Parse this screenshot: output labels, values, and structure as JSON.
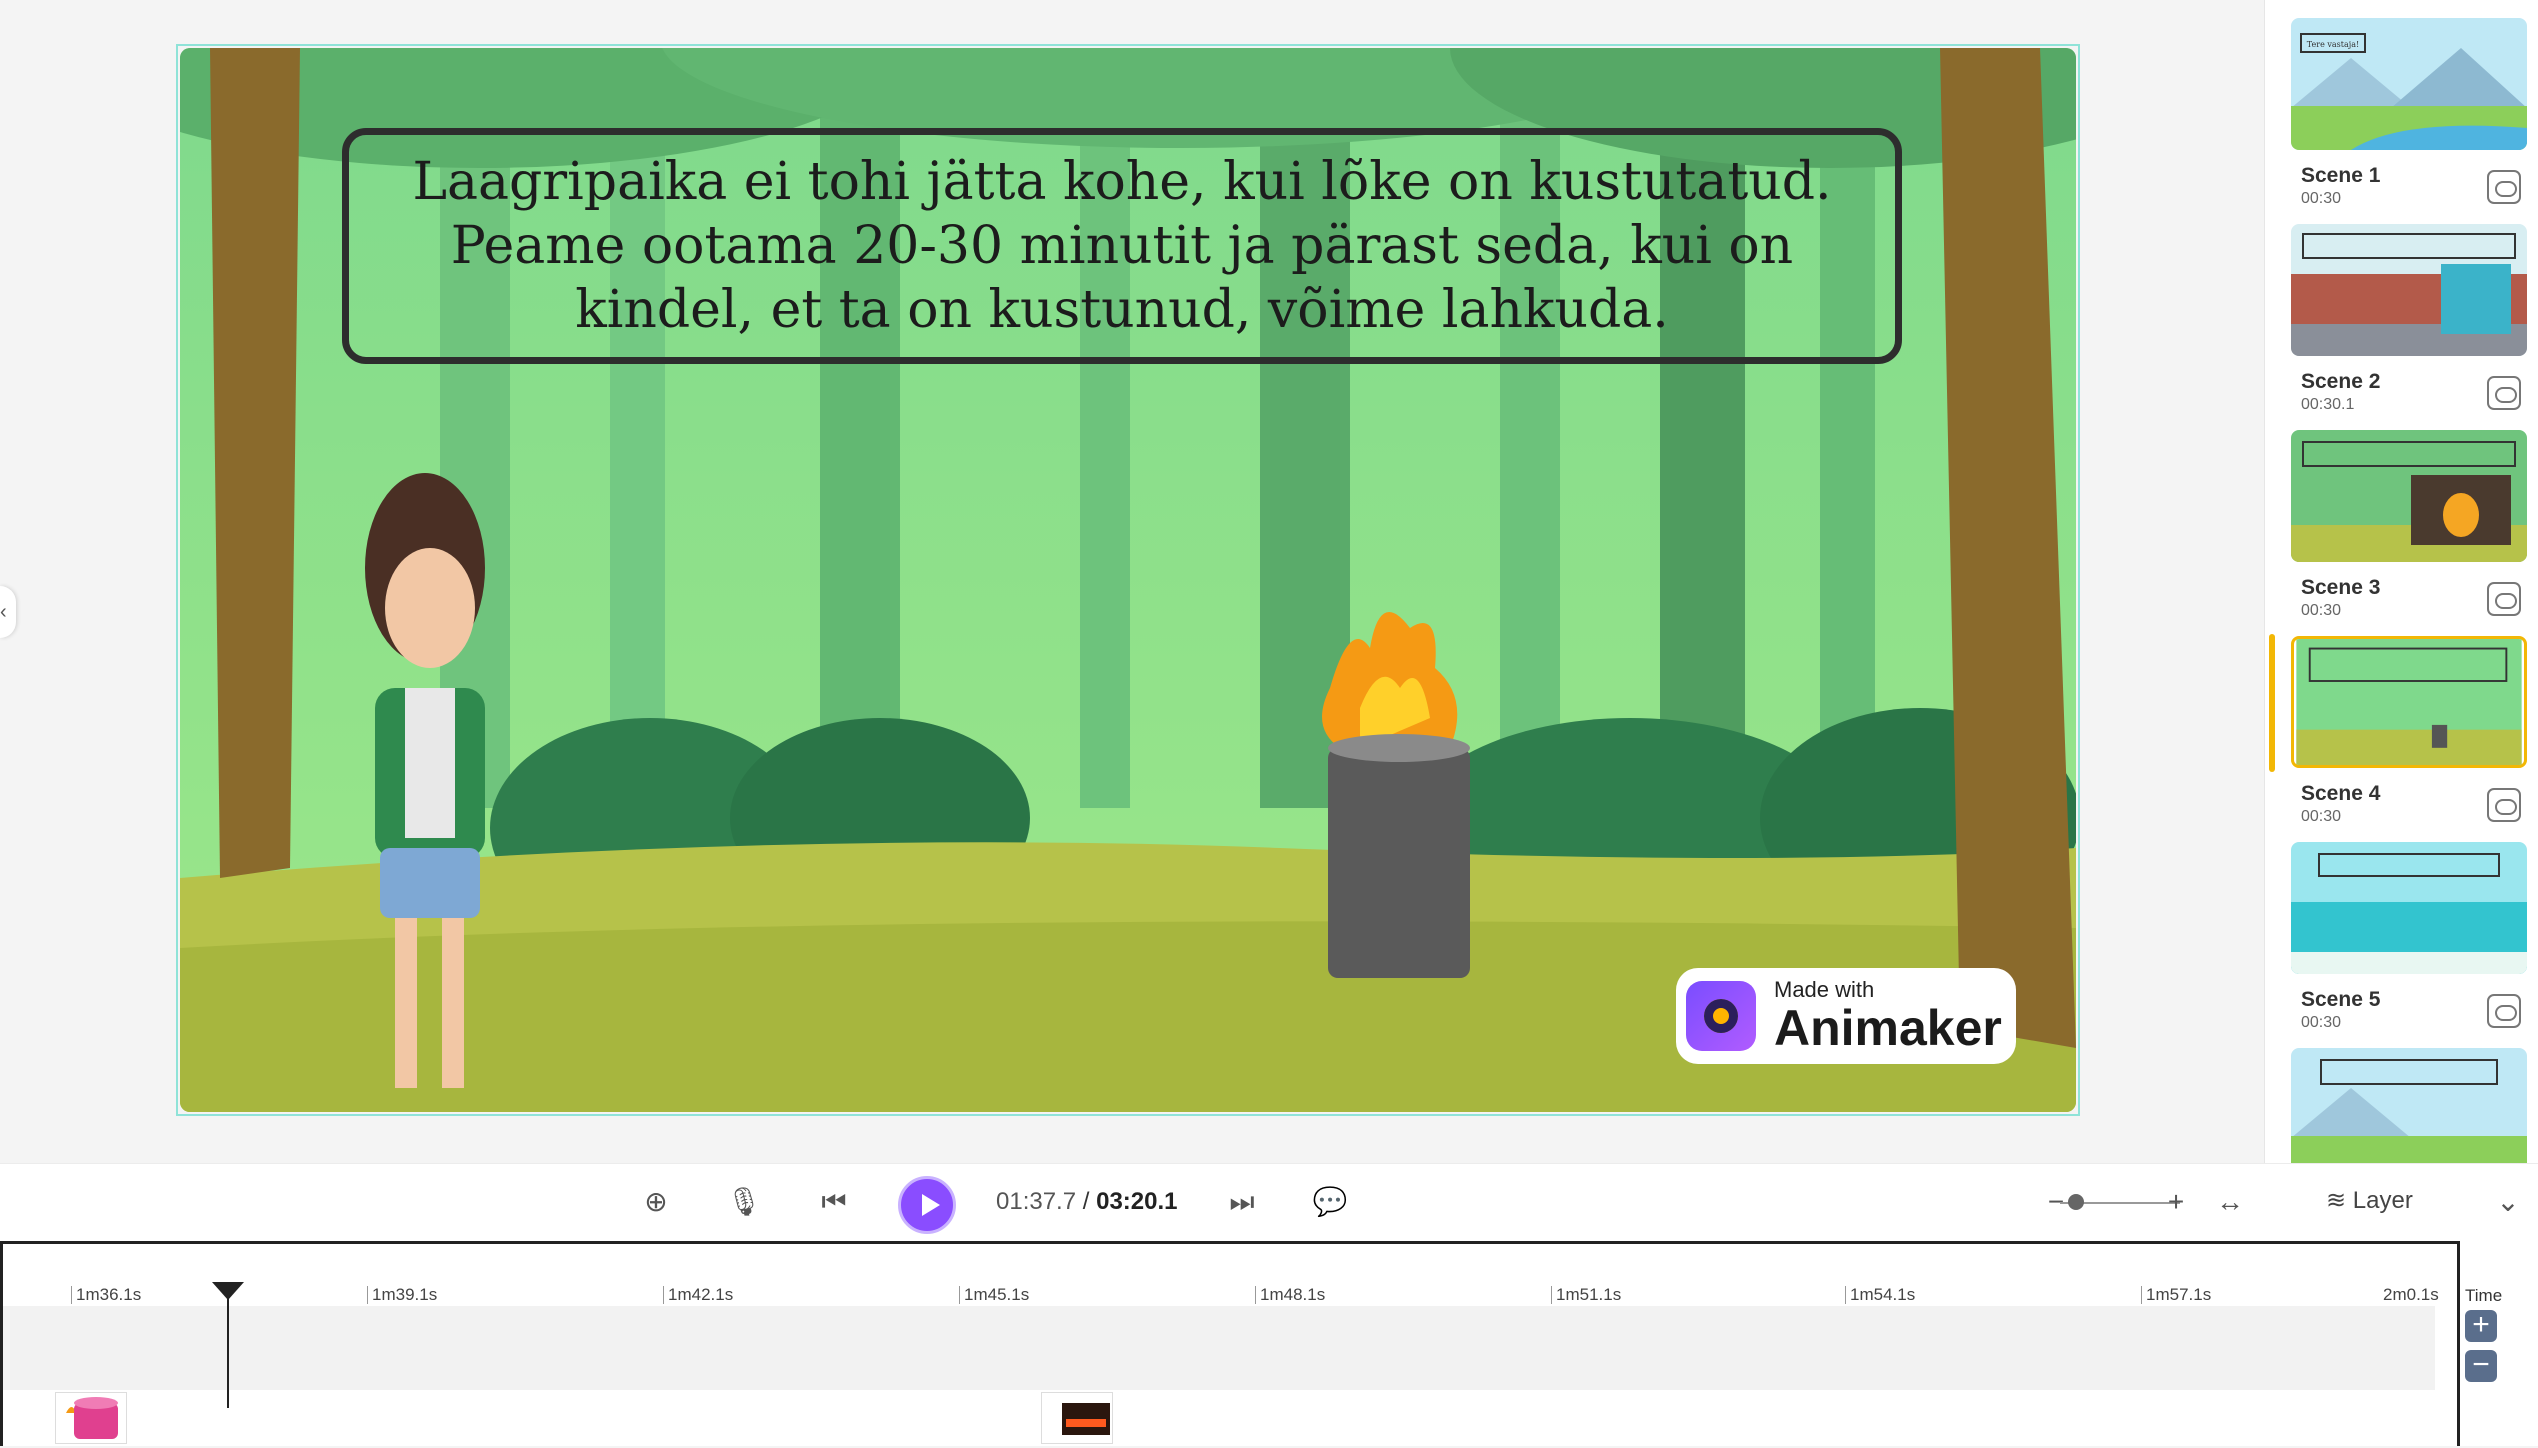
{
  "canvas": {
    "caption": "Laagripaika ei tohi jätta kohe, kui lõke on kustutatud. Peame ootama 20-30 minutit ja pärast seda, kui on kindel, et ta on kustunud, võime lahkuda.",
    "watermark_small": "Made with",
    "watermark_big": "Animaker"
  },
  "scenes": [
    {
      "name": "Scene 1",
      "duration": "00:30",
      "thumb_text": "Tere vastaja!"
    },
    {
      "name": "Scene 2",
      "duration": "00:30.1"
    },
    {
      "name": "Scene 3",
      "duration": "00:30"
    },
    {
      "name": "Scene 4",
      "duration": "00:30",
      "active": true
    },
    {
      "name": "Scene 5",
      "duration": "00:30"
    }
  ],
  "playback": {
    "current_time": "01:37.7",
    "separator": "/",
    "total_time": "03:20.1",
    "layer_label": "Layer",
    "zoom_minus": "−",
    "zoom_plus": "+"
  },
  "timeline": {
    "ticks": [
      "1m36.1s",
      "1m39.1s",
      "1m42.1s",
      "1m45.1s",
      "1m48.1s",
      "1m51.1s",
      "1m54.1s",
      "1m57.1s",
      "2m0.1s"
    ],
    "time_label": "Time",
    "plus": "+",
    "minus": "−"
  },
  "colors": {
    "accent": "#8a4dff",
    "active_scene": "#f2b705",
    "canvas_border": "#8fe3d8"
  }
}
